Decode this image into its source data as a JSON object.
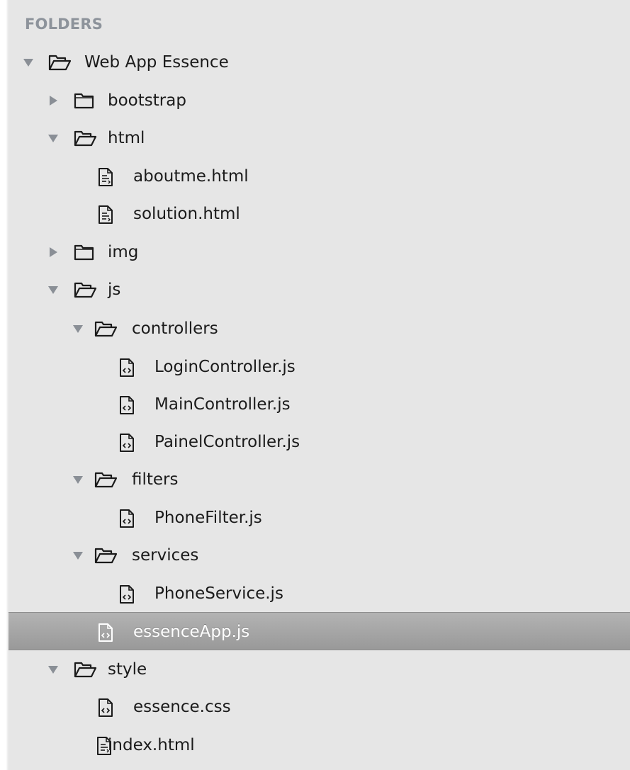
{
  "sidebar": {
    "header": "FOLDERS",
    "colors": {
      "background": "#e6e6e6",
      "header_text": "#8d939b",
      "selected_row": "#a6a6a6",
      "selected_text": "#ffffff"
    },
    "items": [
      {
        "label": "Web App Essence",
        "kind": "folder",
        "expanded": true,
        "icon": "folder-open-icon",
        "selected": false
      },
      {
        "label": "bootstrap",
        "kind": "folder",
        "expanded": false,
        "icon": "folder-icon",
        "selected": false
      },
      {
        "label": "html",
        "kind": "folder",
        "expanded": true,
        "icon": "folder-open-icon",
        "selected": false
      },
      {
        "label": "aboutme.html",
        "kind": "file",
        "icon": "html-file-icon",
        "selected": false
      },
      {
        "label": "solution.html",
        "kind": "file",
        "icon": "html-file-icon",
        "selected": false
      },
      {
        "label": "img",
        "kind": "folder",
        "expanded": false,
        "icon": "folder-icon",
        "selected": false
      },
      {
        "label": "js",
        "kind": "folder",
        "expanded": true,
        "icon": "folder-open-icon",
        "selected": false
      },
      {
        "label": "controllers",
        "kind": "folder",
        "expanded": true,
        "icon": "folder-open-icon",
        "selected": false
      },
      {
        "label": "LoginController.js",
        "kind": "file",
        "icon": "code-file-icon",
        "selected": false
      },
      {
        "label": "MainController.js",
        "kind": "file",
        "icon": "code-file-icon",
        "selected": false
      },
      {
        "label": "PainelController.js",
        "kind": "file",
        "icon": "code-file-icon",
        "selected": false
      },
      {
        "label": "filters",
        "kind": "folder",
        "expanded": true,
        "icon": "folder-open-icon",
        "selected": false
      },
      {
        "label": "PhoneFilter.js",
        "kind": "file",
        "icon": "code-file-icon",
        "selected": false
      },
      {
        "label": "services",
        "kind": "folder",
        "expanded": true,
        "icon": "folder-open-icon",
        "selected": false
      },
      {
        "label": "PhoneService.js",
        "kind": "file",
        "icon": "code-file-icon",
        "selected": false
      },
      {
        "label": "essenceApp.js",
        "kind": "file",
        "icon": "code-file-icon",
        "selected": true
      },
      {
        "label": "style",
        "kind": "folder",
        "expanded": true,
        "icon": "folder-open-icon",
        "selected": false
      },
      {
        "label": "essence.css",
        "kind": "file",
        "icon": "code-file-icon",
        "selected": false
      },
      {
        "label": "index.html",
        "kind": "file",
        "icon": "html-file-icon",
        "selected": false
      }
    ]
  }
}
